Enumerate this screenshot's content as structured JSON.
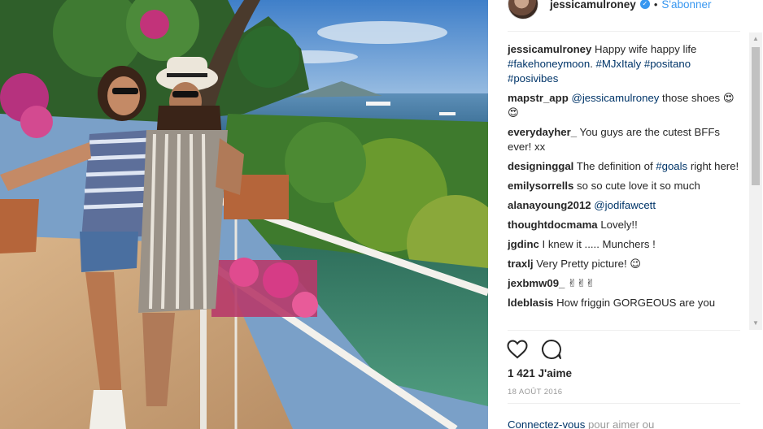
{
  "header": {
    "username": "jessicamulroney",
    "follow_label": "S'abonner"
  },
  "comments": [
    {
      "user": "jessicamulroney",
      "segments": [
        {
          "t": "text",
          "v": "Happy wife happy life "
        },
        {
          "t": "tag",
          "v": "#fakehoneymoon"
        },
        {
          "t": "text",
          "v": ". "
        },
        {
          "t": "tag",
          "v": "#MJxItaly"
        },
        {
          "t": "text",
          "v": " "
        },
        {
          "t": "tag",
          "v": "#positano"
        },
        {
          "t": "text",
          "v": " "
        },
        {
          "t": "tag",
          "v": "#posivibes"
        }
      ]
    },
    {
      "user": "mapstr_app",
      "segments": [
        {
          "t": "tag",
          "v": "@jessicamulroney"
        },
        {
          "t": "text",
          "v": " those shoes 😍😍"
        }
      ]
    },
    {
      "user": "everydayher_",
      "segments": [
        {
          "t": "text",
          "v": "You guys are the cutest BFFs ever! xx"
        }
      ]
    },
    {
      "user": "designinggal",
      "segments": [
        {
          "t": "text",
          "v": "The definition of "
        },
        {
          "t": "tag",
          "v": "#goals"
        },
        {
          "t": "text",
          "v": " right here!"
        }
      ]
    },
    {
      "user": "emilysorrells",
      "segments": [
        {
          "t": "text",
          "v": "so so cute love it so much"
        }
      ]
    },
    {
      "user": "alanayoung2012",
      "segments": [
        {
          "t": "tag",
          "v": "@jodifawcett"
        }
      ]
    },
    {
      "user": "thoughtdocmama",
      "segments": [
        {
          "t": "text",
          "v": "Lovely!!"
        }
      ]
    },
    {
      "user": "jgdinc",
      "segments": [
        {
          "t": "text",
          "v": "I knew it ..... Munchers !"
        }
      ]
    },
    {
      "user": "traxlj",
      "segments": [
        {
          "t": "text",
          "v": "Very Pretty picture! 😉"
        }
      ]
    },
    {
      "user": "jexbmw09_",
      "segments": [
        {
          "t": "text",
          "v": "✌✌✌"
        }
      ]
    },
    {
      "user": "ldeblasis",
      "segments": [
        {
          "t": "text",
          "v": "How friggin GORGEOUS are you"
        }
      ]
    }
  ],
  "actions": {
    "like_icon": "heart-outline-icon",
    "comment_icon": "comment-bubble-icon"
  },
  "likes_label": "1 421 J'aime",
  "date_label": "18 AOÛT 2016",
  "login": {
    "link": "Connectez-vous",
    "rest": " pour aimer ou"
  },
  "colors": {
    "link_blue": "#3897f0",
    "tag_blue": "#003569",
    "muted": "#999999",
    "text": "#262626"
  }
}
